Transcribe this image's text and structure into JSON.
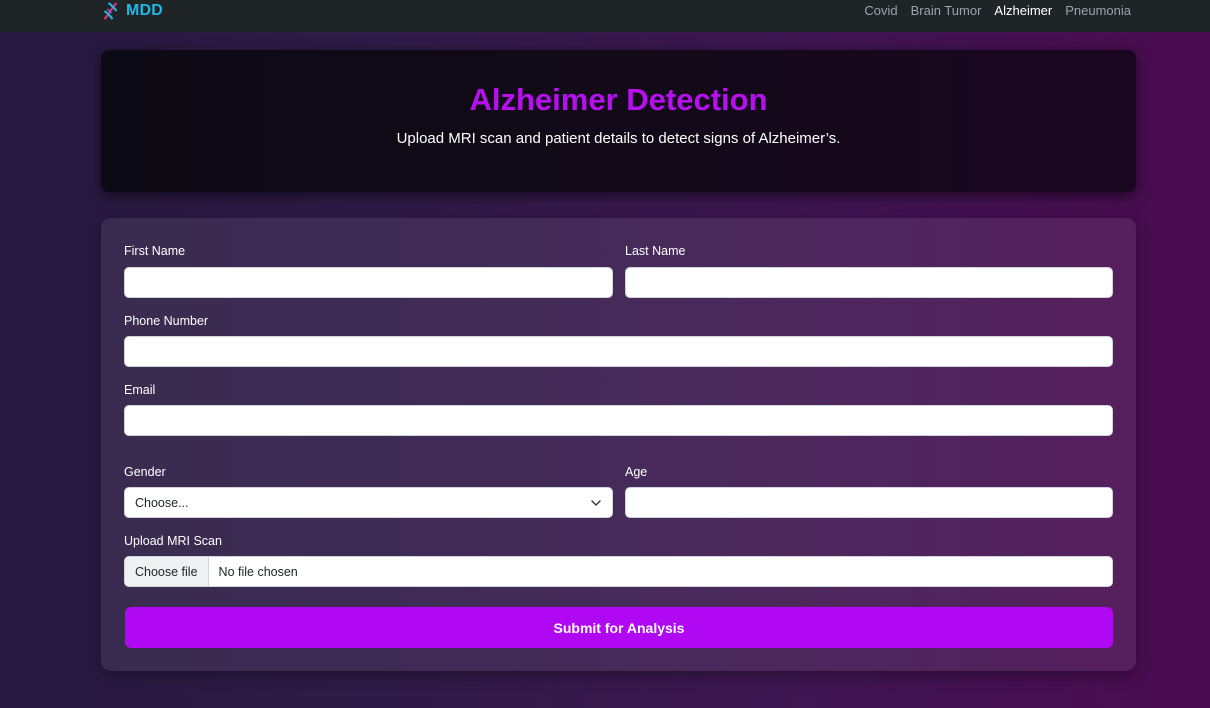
{
  "navbar": {
    "brand": "MDD",
    "brand_icon": "dna-icon",
    "links": [
      {
        "label": "Covid",
        "active": false
      },
      {
        "label": "Brain Tumor",
        "active": false
      },
      {
        "label": "Alzheimer",
        "active": true
      },
      {
        "label": "Pneumonia",
        "active": false
      }
    ]
  },
  "hero": {
    "title": "Alzheimer Detection",
    "subtitle": "Upload MRI scan and patient details to detect signs of Alzheimer’s."
  },
  "form": {
    "first_name": {
      "label": "First Name",
      "value": "",
      "placeholder": ""
    },
    "last_name": {
      "label": "Last Name",
      "value": "",
      "placeholder": ""
    },
    "phone": {
      "label": "Phone Number",
      "value": "",
      "placeholder": ""
    },
    "email": {
      "label": "Email",
      "value": "",
      "placeholder": ""
    },
    "gender": {
      "label": "Gender",
      "selected": "Choose..."
    },
    "age": {
      "label": "Age",
      "value": "",
      "placeholder": ""
    },
    "mri": {
      "label": "Upload MRI Scan",
      "button": "Choose file",
      "status": "No file chosen"
    },
    "submit_label": "Submit for Analysis"
  },
  "colors": {
    "accent": "#b008f2",
    "title": "#b80ff0",
    "brand": "#1fb8e6",
    "navbar_bg": "#1f2426"
  }
}
